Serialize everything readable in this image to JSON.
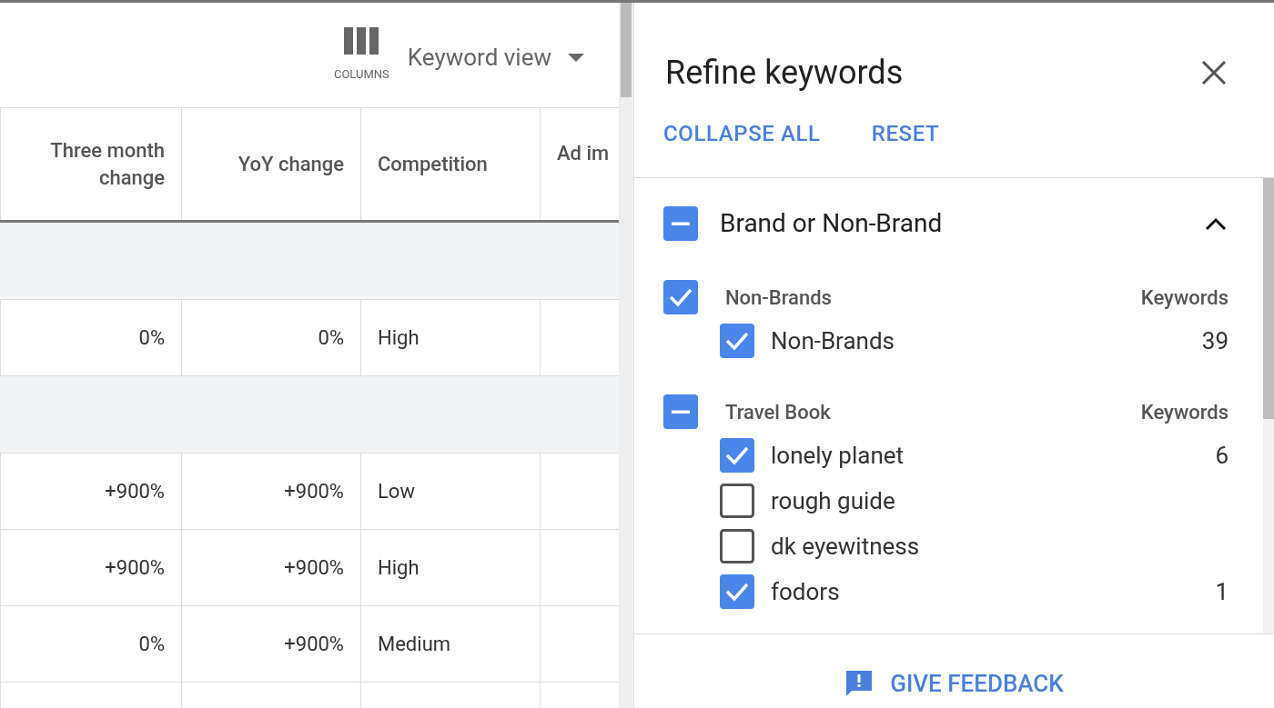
{
  "toolbar": {
    "columns_label": "COLUMNS",
    "view_dropdown": "Keyword view"
  },
  "table": {
    "columns": [
      "Three month change",
      "YoY change",
      "Competition",
      "Ad im"
    ],
    "rows": [
      {
        "kind": "group"
      },
      {
        "kind": "data",
        "cells": [
          "0%",
          "0%",
          "High",
          ""
        ]
      },
      {
        "kind": "group"
      },
      {
        "kind": "data",
        "cells": [
          "+900%",
          "+900%",
          "Low",
          ""
        ]
      },
      {
        "kind": "data",
        "cells": [
          "+900%",
          "+900%",
          "High",
          ""
        ]
      },
      {
        "kind": "data",
        "cells": [
          "0%",
          "+900%",
          "Medium",
          ""
        ]
      }
    ]
  },
  "panel": {
    "title": "Refine keywords",
    "actions": [
      "COLLAPSE ALL",
      "RESET"
    ],
    "section": {
      "title": "Brand or Non-Brand",
      "indeterminate": true,
      "expanded": true,
      "groups": [
        {
          "name": "Non-Brands",
          "count_header": "Keywords",
          "checked": true,
          "indeterminate": false,
          "items": [
            {
              "label": "Non-Brands",
              "count": "39",
              "checked": true
            }
          ]
        },
        {
          "name": "Travel Book",
          "count_header": "Keywords",
          "indeterminate": true,
          "items": [
            {
              "label": "lonely planet",
              "count": "6",
              "checked": true
            },
            {
              "label": "rough guide",
              "checked": false
            },
            {
              "label": "dk eyewitness",
              "checked": false
            },
            {
              "label": "fodors",
              "count": "1",
              "checked": true
            }
          ]
        }
      ]
    },
    "feedback": "GIVE FEEDBACK"
  }
}
